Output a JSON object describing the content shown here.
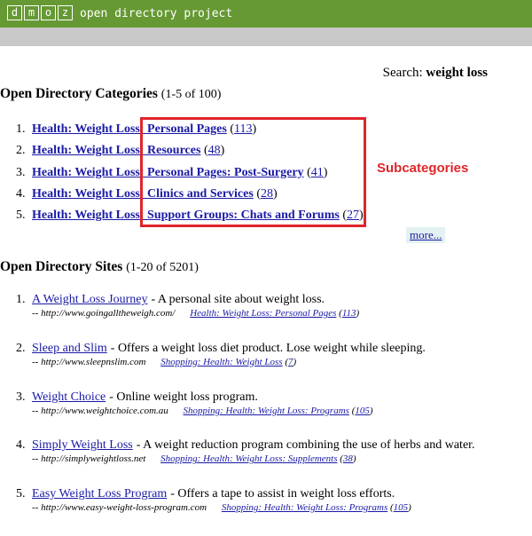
{
  "header": {
    "logo_letters": [
      "d",
      "m",
      "o",
      "z"
    ],
    "logo_text": "open directory project"
  },
  "search": {
    "label": "Search:",
    "query": "weight loss"
  },
  "categories": {
    "title": "Open Directory Categories",
    "count": "(1-5 of 100)",
    "items": [
      {
        "num": "1.",
        "cat": "Health: Weight Loss:",
        "sub": "Personal Pages",
        "count": "113"
      },
      {
        "num": "2.",
        "cat": "Health: Weight Loss:",
        "sub": "Resources",
        "count": "48"
      },
      {
        "num": "3.",
        "cat": "Health: Weight Loss:",
        "sub": "Personal Pages: Post-Surgery",
        "count": "41"
      },
      {
        "num": "4.",
        "cat": "Health: Weight Loss:",
        "sub": "Clinics and Services",
        "count": "28"
      },
      {
        "num": "5.",
        "cat": "Health: Weight Loss:",
        "sub": "Support Groups: Chats and Forums",
        "count": "27"
      }
    ],
    "more_label": "more...",
    "annotation_label": "Subcategories",
    "annotation_color": "#e0252a"
  },
  "sites": {
    "title": "Open Directory Sites",
    "count": "(1-20 of 5201)",
    "items": [
      {
        "num": "1.",
        "title": "A Weight Loss Journey",
        "desc": "- A personal site about weight loss.",
        "url": "-- http://www.goingalltheweigh.com/",
        "cat": "Health: Weight Loss: Personal Pages",
        "count": "113"
      },
      {
        "num": "2.",
        "title": "Sleep and Slim",
        "desc": "- Offers a weight loss diet product. Lose weight while sleeping.",
        "url": "-- http://www.sleepnslim.com",
        "cat": "Shopping: Health: Weight Loss",
        "count": "7"
      },
      {
        "num": "3.",
        "title": "Weight Choice",
        "desc": "- Online weight loss program.",
        "url": "-- http://www.weightchoice.com.au",
        "cat": "Shopping: Health: Weight Loss: Programs",
        "count": "105"
      },
      {
        "num": "4.",
        "title": "Simply Weight Loss",
        "desc": "- A weight reduction program combining the use of herbs and water.",
        "url": "-- http://simplyweightloss.net",
        "cat": "Shopping: Health: Weight Loss: Supplements",
        "count": "38"
      },
      {
        "num": "5.",
        "title": "Easy Weight Loss Program",
        "desc": "- Offers a tape to assist in weight loss efforts.",
        "url": "-- http://www.easy-weight-loss-program.com",
        "cat": "Shopping: Health: Weight Loss: Programs",
        "count": "105"
      }
    ]
  },
  "colors": {
    "header_bg": "#669933",
    "link": "#1a1aa6",
    "more_bg": "#e3f1f1"
  }
}
